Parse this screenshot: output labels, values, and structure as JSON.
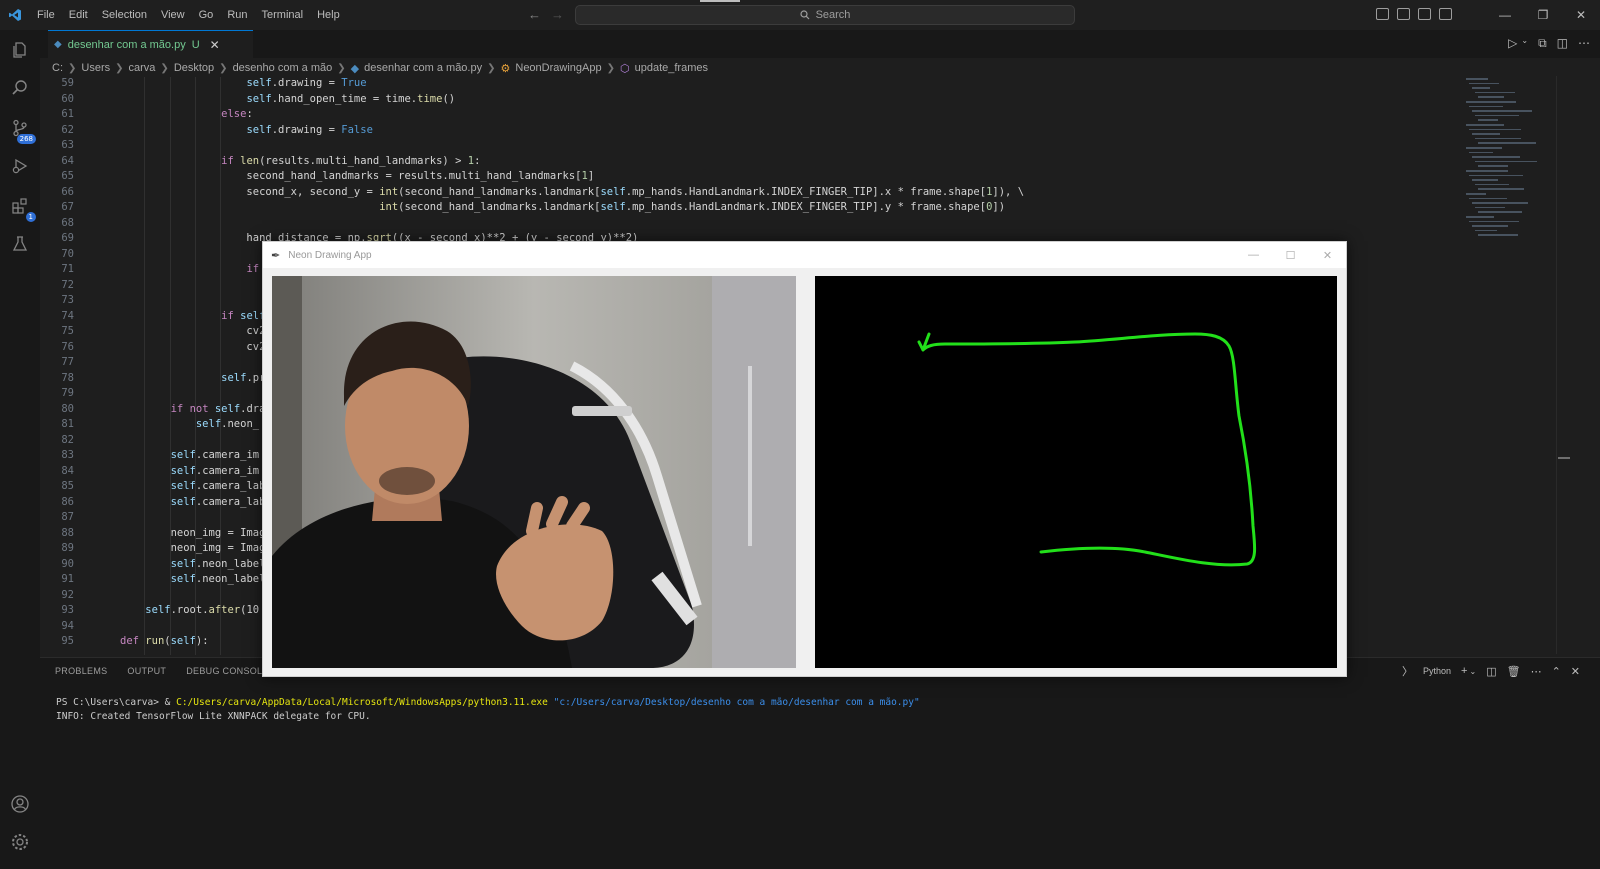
{
  "menu": [
    "File",
    "Edit",
    "Selection",
    "View",
    "Go",
    "Run",
    "Terminal",
    "Help"
  ],
  "search": {
    "placeholder": "Search"
  },
  "tab": {
    "filename": "desenhar com a mão.py",
    "status": "U"
  },
  "breadcrumb": {
    "items": [
      "C:",
      "Users",
      "carva",
      "Desktop",
      "desenho com a mão",
      "desenhar com a mão.py",
      "NeonDrawingApp",
      "update_frames"
    ]
  },
  "activity": {
    "scm_badge": "268",
    "ext_badge": "1"
  },
  "code": {
    "line_numbers": [
      "59",
      "60",
      "61",
      "62",
      "63",
      "64",
      "65",
      "66",
      "67",
      "68",
      "69",
      "70",
      "71",
      "72",
      "73",
      "74",
      "75",
      "76",
      "77",
      "78",
      "79",
      "80",
      "81",
      "82",
      "83",
      "84",
      "85",
      "86",
      "87",
      "88",
      "89",
      "90",
      "91",
      "92",
      "93",
      "94",
      "95"
    ],
    "lines": [
      "                    self.drawing = True",
      "                    self.hand_open_time = time.time()",
      "                else:",
      "                    self.drawing = False",
      "",
      "                if len(results.multi_hand_landmarks) > 1:",
      "                    second_hand_landmarks = results.multi_hand_landmarks[1]",
      "                    second_x, second_y = int(second_hand_landmarks.landmark[self.mp_hands.HandLandmark.INDEX_FINGER_TIP].x * frame.shape[1]), \\",
      "                                         int(second_hand_landmarks.landmark[self.mp_hands.HandLandmark.INDEX_FINGER_TIP].y * frame.shape[0])",
      "",
      "                    hand_distance = np.sqrt((x - second_x)**2 + (y - second_y)**2)",
      "",
      "                    if",
      "",
      "",
      "                if self",
      "                    cv2",
      "                    cv2",
      "",
      "                self.pr",
      "",
      "        if not self.dra",
      "            self.neon_",
      "",
      "        self.camera_im",
      "        self.camera_im",
      "        self.camera_lab",
      "        self.camera_lab",
      "",
      "        neon_img = Imag",
      "        neon_img = Imag",
      "        self.neon_label",
      "        self.neon_label",
      "",
      "    self.root.after(10",
      "",
      "def run(self):"
    ]
  },
  "panel": {
    "tabs": [
      "PROBLEMS",
      "OUTPUT",
      "DEBUG CONSOLE"
    ],
    "shell_label": "Python",
    "terminal": {
      "prompt": "PS C:\\Users\\carva> & ",
      "exe": "C:/Users/carva/AppData/Local/Microsoft/WindowsApps/python3.11.exe",
      "arg": "\"c:/Users/carva/Desktop/desenho com a mão/desenhar com a mão.py\"",
      "line2": "INFO: Created TensorFlow Lite XNNPACK delegate for CPU."
    }
  },
  "app_window": {
    "title": "Neon Drawing App",
    "stroke_color": "#22e01a"
  },
  "colors": {
    "accent": "#0078d4",
    "modified": "#73c991"
  }
}
